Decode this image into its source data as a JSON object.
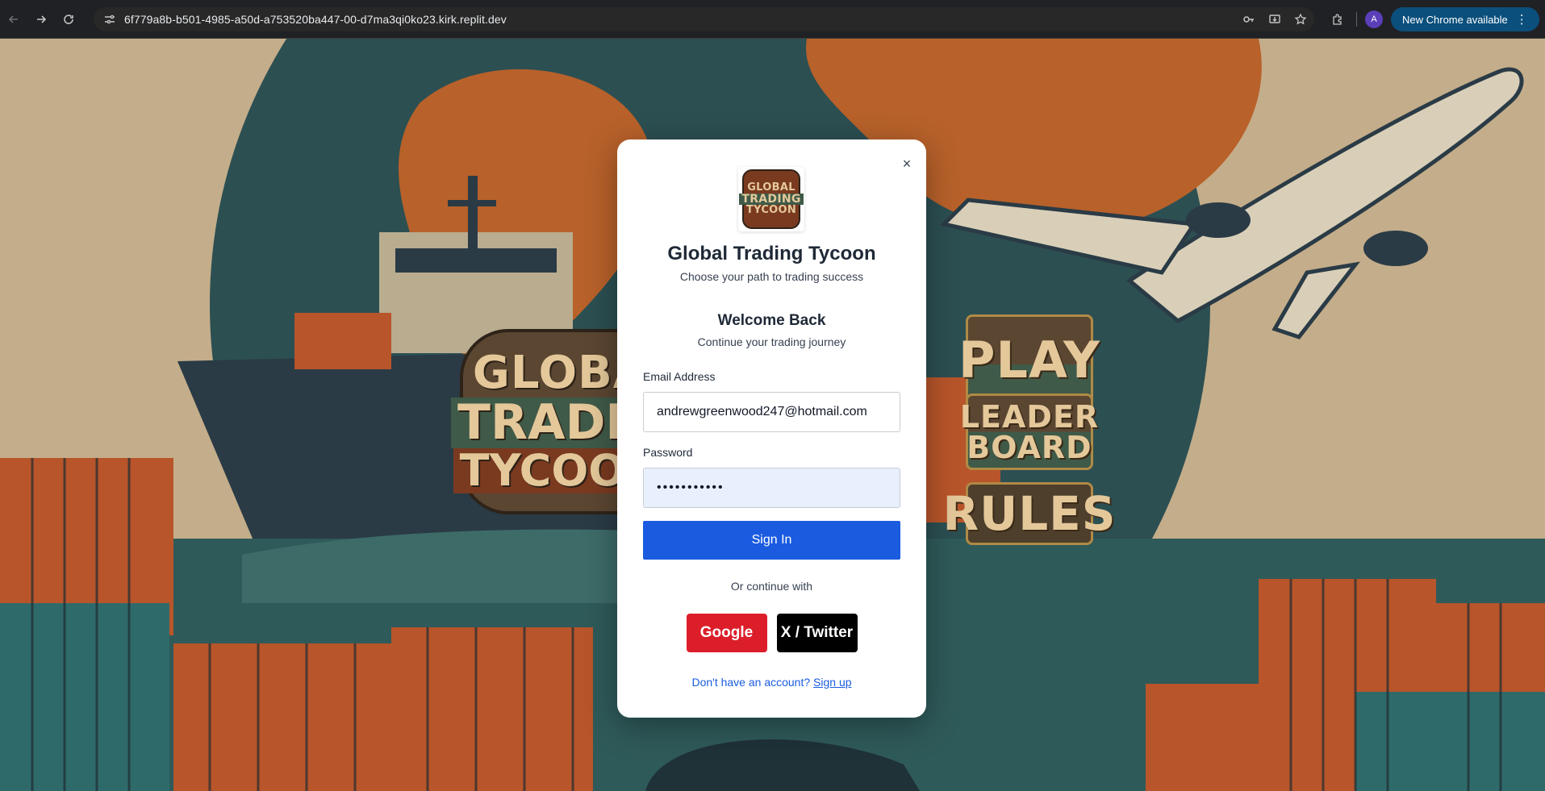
{
  "browser": {
    "url": "6f779a8b-b501-4985-a50d-a753520ba447-00-d7ma3qi0ko23.kirk.replit.dev",
    "profile_initial": "A",
    "update_chip_label": "New Chrome available"
  },
  "background": {
    "title_sign": {
      "line1": "GLOBA",
      "line2": "TRADIN",
      "line3": "TYCOON"
    },
    "menu": {
      "play": "PLAY",
      "leaderboard_line1": "LEADER",
      "leaderboard_line2": "BOARD",
      "rules": "RULES"
    }
  },
  "modal": {
    "close_label": "×",
    "logo": {
      "line1": "GLOBAL",
      "line2": "TRADING",
      "line3": "TYCOON"
    },
    "title": "Global Trading Tycoon",
    "subtitle": "Choose your path to trading success",
    "welcome_title": "Welcome Back",
    "welcome_subtitle": "Continue your trading journey",
    "email_label": "Email Address",
    "email_value": "andrewgreenwood247@hotmail.com",
    "password_label": "Password",
    "password_value": "•••••••••••",
    "signin_label": "Sign In",
    "or_text": "Or continue with",
    "google_label": "Google",
    "twitter_label": "X / Twitter",
    "signup_prompt": "Don't have an account?",
    "signup_link": "Sign up"
  },
  "colors": {
    "primary": "#1a5be0",
    "google": "#dc1e2b",
    "twitter": "#000000",
    "update_chip": "#0b4f7c"
  }
}
